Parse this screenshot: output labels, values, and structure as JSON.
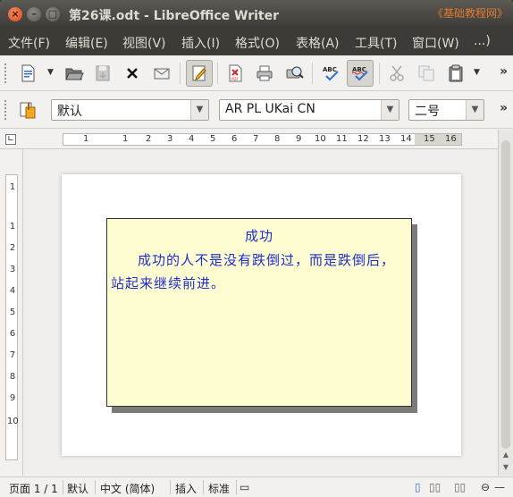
{
  "window": {
    "title": "第26课.odt - LibreOffice Writer",
    "watermark": "《基础教程网》",
    "controls": {
      "close": "×",
      "minimize": "–",
      "maximize": "□"
    }
  },
  "menu": [
    "文件(F)",
    "编辑(E)",
    "视图(V)",
    "插入(I)",
    "格式(O)",
    "表格(A)",
    "工具(T)",
    "窗口(W)",
    "...)"
  ],
  "toolbar2": {
    "style": "默认",
    "font": "AR PL UKai CN",
    "size": "二号"
  },
  "ruler": {
    "h_ticks": [
      "1",
      "1",
      "2",
      "3",
      "4",
      "5",
      "6",
      "7",
      "8",
      "9",
      "10",
      "11",
      "12",
      "13",
      "14",
      "15",
      "16"
    ],
    "v_ticks": [
      "1",
      "1",
      "2",
      "3",
      "4",
      "5",
      "6",
      "7",
      "8",
      "9",
      "10"
    ]
  },
  "document": {
    "frame_title": "成功",
    "frame_body": "成功的人不是没有跌倒过，而是跌倒后，站起来继续前进。"
  },
  "status": {
    "page": "页面 1 / 1",
    "style": "默认",
    "language": "中文 (简体)",
    "mode": "插入",
    "selection": "标准"
  },
  "colors": {
    "frame_bg": "#fefdd2",
    "text": "#1e2ec9",
    "titlebar": "#3c3b37"
  }
}
